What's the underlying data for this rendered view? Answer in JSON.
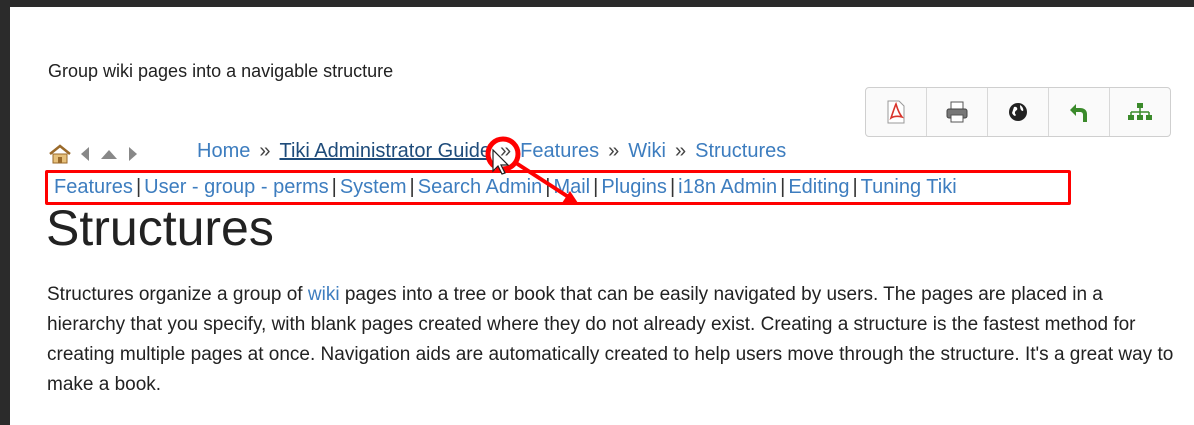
{
  "subtitle": "Group wiki pages into a navigable structure",
  "toolbar": [
    {
      "name": "pdf-icon",
      "color": "#d9342b"
    },
    {
      "name": "print-icon",
      "color": "#555555"
    },
    {
      "name": "globe-icon",
      "color": "#222222"
    },
    {
      "name": "back-arrow-icon",
      "color": "#3b8a2b"
    },
    {
      "name": "structure-icon",
      "color": "#3b8a2b"
    }
  ],
  "breadcrumb": {
    "items": [
      "Home",
      "Tiki Administrator Guide",
      "Features",
      "Wiki",
      "Structures"
    ],
    "separator": "»"
  },
  "subnav": {
    "items": [
      "Features",
      "User - group - perms",
      "System",
      "Search Admin",
      "Mail",
      "Plugins",
      "i18n Admin",
      "Editing",
      "Tuning Tiki"
    ],
    "separator": "|"
  },
  "heading": "Structures",
  "paragraph": {
    "before": "Structures organize a group of ",
    "link": "wiki",
    "after": " pages into a tree or book that can be easily navigated by users. The pages are placed in a hierarchy that you specify, with blank pages created where they do not already exist. Creating a structure is the fastest method for creating multiple pages at once. Navigation aids are automatically created to help users move through the structure. It's a great way to make a book."
  },
  "colors": {
    "link": "#3d7dbf",
    "highlight": "#ff0000"
  }
}
